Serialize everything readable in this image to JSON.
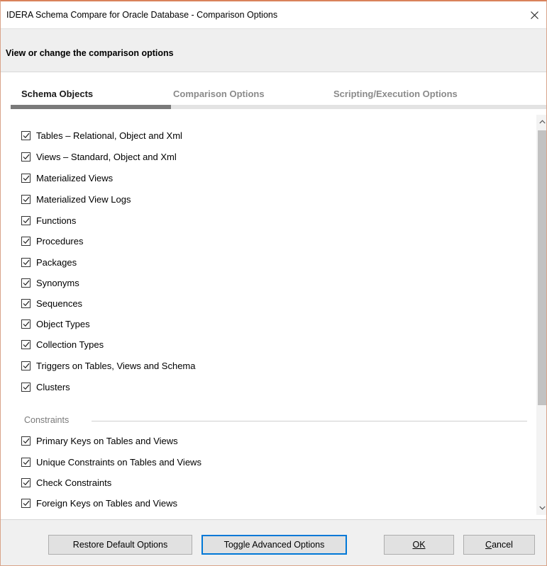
{
  "window": {
    "title": "IDERA Schema Compare for Oracle Database - Comparison Options"
  },
  "header": {
    "text": "View or change the comparison options"
  },
  "tabs": [
    {
      "label": "Schema Objects",
      "active": true
    },
    {
      "label": "Comparison Options",
      "active": false
    },
    {
      "label": "Scripting/Execution Options",
      "active": false
    }
  ],
  "schema_objects": {
    "items": [
      {
        "label": "Tables – Relational, Object and Xml",
        "checked": true
      },
      {
        "label": "Views – Standard, Object and Xml",
        "checked": true
      },
      {
        "label": "Materialized Views",
        "checked": true
      },
      {
        "label": "Materialized View Logs",
        "checked": true
      },
      {
        "label": "Functions",
        "checked": true
      },
      {
        "label": "Procedures",
        "checked": true
      },
      {
        "label": "Packages",
        "checked": true
      },
      {
        "label": "Synonyms",
        "checked": true
      },
      {
        "label": "Sequences",
        "checked": true
      },
      {
        "label": "Object Types",
        "checked": true
      },
      {
        "label": "Collection Types",
        "checked": true
      },
      {
        "label": "Triggers on Tables, Views and Schema",
        "checked": true
      },
      {
        "label": "Clusters",
        "checked": true
      }
    ]
  },
  "constraints": {
    "group_label": "Constraints",
    "items": [
      {
        "label": "Primary Keys on Tables and Views",
        "checked": true
      },
      {
        "label": "Unique Constraints on Tables and Views",
        "checked": true
      },
      {
        "label": "Check Constraints",
        "checked": true
      },
      {
        "label": "Foreign Keys on Tables and Views",
        "checked": true
      }
    ]
  },
  "footer": {
    "restore_label": "Restore Default Options",
    "toggle_label": "Toggle Advanced Options",
    "ok_label": "OK",
    "cancel_label": "Cancel"
  },
  "icons": {
    "close": "close-icon",
    "check": "checkmark-icon",
    "scroll_up": "chevron-up-icon",
    "scroll_down": "chevron-down-icon"
  },
  "colors": {
    "window_border": "#d9825b",
    "active_tab_indicator": "#7a7a7a",
    "focused_button_border": "#0078d7"
  }
}
